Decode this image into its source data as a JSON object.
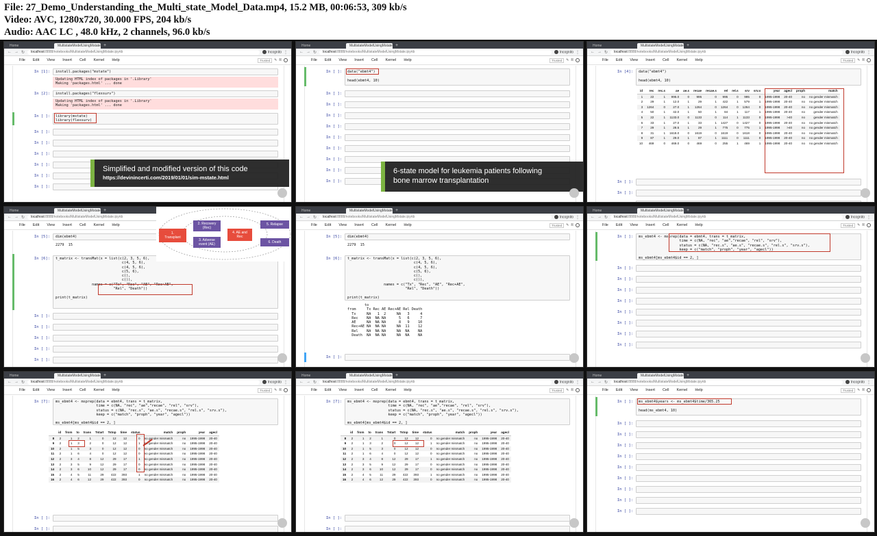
{
  "header": {
    "file_line": "File: 27_Demo_Understanding_the_Multi_state_Model_Data.mp4, 15.2 MB, 00:06:53, 309 kb/s",
    "video_line": "Video: AVC, 1280x720, 30.000 FPS, 204 kb/s",
    "audio_line": "Audio: AAC LC , 48.0 kHz, 2 channels, 96.0 kb/s"
  },
  "browser": {
    "tab_home": "Home",
    "tab_nb": "MultistateModelUsingMstate",
    "url_host": "localhost",
    "url_path": ":8888/notebooks/MultistateModelUsingMstate.ipynb",
    "incognito": "Incognito",
    "trusted": "Trusted",
    "kernel_label": "R"
  },
  "menu": [
    "File",
    "Edit",
    "View",
    "Insert",
    "Cell",
    "Kernel",
    "Help"
  ],
  "thumb0": {
    "p1": "In [1]:",
    "c1": "install.packages(\"mstate\")",
    "e1": "Updating HTML index of packages in '.Library'\nMaking 'packages.html' ... done",
    "p2": "In [2]:",
    "c2": "install.packages(\"flexsurv\")",
    "e2": "Updating HTML index of packages in '.Library'\nMaking 'packages.html' ... done",
    "p3": "In [ ]:",
    "c3": "library(mstate)\nlibrary(flexsurv)",
    "empty": "In [ ]:",
    "caption_main": "Simplified and modified version of this code",
    "caption_sub": "https://devinincerti.com/2019/01/01/sim-mstate.html"
  },
  "thumb1": {
    "p1": "In [ ]:",
    "c1": "data(\"ebmt4\")\n\nhead(ebmt4, 10)",
    "empty": "In [ ]:",
    "caption_main": "6-state model for leukemia patients following\nbone marrow transplantation"
  },
  "thumb2": {
    "p1": "In [4]:",
    "c1": "data(\"ebmt4\")\n\nhead(ebmt4, 10)",
    "empty": "In [ ]:",
    "columns": [
      "id",
      "rec",
      "rec.s",
      "ae",
      "ae.s",
      "recae",
      "recae.s",
      "rel",
      "rel.s",
      "srv",
      "srv.s",
      "year",
      "agecl",
      "proph",
      "match"
    ],
    "rows": [
      [
        "1",
        "22",
        "1",
        "995.0",
        "0",
        "995",
        "0",
        "995",
        "0",
        "995",
        "0",
        "1995-1998",
        "20-40",
        "no",
        "no gender mismatch"
      ],
      [
        "2",
        "29",
        "1",
        "12.0",
        "1",
        "29",
        "1",
        "422",
        "1",
        "579",
        "1",
        "1995-1998",
        "20-40",
        "no",
        "no gender mismatch"
      ],
      [
        "3",
        "1264",
        "0",
        "27.0",
        "1",
        "1264",
        "0",
        "1264",
        "0",
        "1264",
        "0",
        "1995-1998",
        "20-40",
        "no",
        "no gender mismatch"
      ],
      [
        "4",
        "50",
        "1",
        "42.0",
        "1",
        "50",
        "1",
        "84",
        "1",
        "117",
        "1",
        "1995-1998",
        "20-40",
        "no",
        "gender mismatch"
      ],
      [
        "5",
        "22",
        "1",
        "1133.0",
        "0",
        "1133",
        "0",
        "114",
        "1",
        "1133",
        "0",
        "1995-1998",
        ">40",
        "no",
        "gender mismatch"
      ],
      [
        "6",
        "33",
        "1",
        "27.0",
        "1",
        "33",
        "1",
        "1427",
        "0",
        "1427",
        "0",
        "1995-1998",
        "20-40",
        "no",
        "no gender mismatch"
      ],
      [
        "7",
        "29",
        "1",
        "28.5",
        "1",
        "29",
        "1",
        "775",
        "0",
        "775",
        "1",
        "1995-1998",
        ">40",
        "no",
        "no gender mismatch"
      ],
      [
        "8",
        "31",
        "1",
        "1618.0",
        "0",
        "1619",
        "0",
        "1619",
        "0",
        "1618",
        "0",
        "1995-1998",
        "20-40",
        "no",
        "no gender mismatch"
      ],
      [
        "9",
        "87",
        "1",
        "29.0",
        "1",
        "87",
        "1",
        "1111",
        "0",
        "1111",
        "0",
        "1995-1998",
        "20-40",
        "no",
        "no gender mismatch"
      ],
      [
        "10",
        "469",
        "0",
        "469.0",
        "0",
        "469",
        "0",
        "255",
        "1",
        "469",
        "1",
        "1995-1998",
        "20-40",
        "no",
        "no gender mismatch"
      ]
    ]
  },
  "thumb3": {
    "p1": "In [5]:",
    "c1": "dim(ebmt4)",
    "o1": "2279  15",
    "p2": "In [6]:",
    "c2": "t_matrix <- transMat(x = list(c(2, 3, 5, 6),\n                               c(4, 5, 6),\n                               c(4, 5, 6),\n                               c(5, 6),\n                               c(),\n                               c()),\n                 names = c(\"Tx\", \"Rec\", \"AE\", \"Rec+AE\",\n                           \"Rel\", \"Death\"))\n\nprint(t_matrix)",
    "empty": "In [ ]:",
    "d_transplant": "1.\nTransplant",
    "d_recovery": "2. Recovery\n(Rec)",
    "d_adverse": "3. Adverse\nevent (AE)",
    "d_aerec": "4. AE and\nRec",
    "d_relapse": "5. Relapse",
    "d_death": "6. Death"
  },
  "thumb4": {
    "p1": "In [5]:",
    "c1": "dim(ebmt4)",
    "o1": "2279  15",
    "p2": "In [6]:",
    "c2": "t_matrix <- transMat(x = list(c(2, 3, 5, 6),\n                               c(4, 5, 6),\n                               c(4, 5, 6),\n                               c(5, 6),\n                               c(),\n                               c()),\n                 names = c(\"Tx\", \"Rec\", \"AE\", \"Rec+AE\",\n                           \"Rel\", \"Death\"))\n\nprint(t_matrix)",
    "o2": "        to\nfrom     Tx Rec AE Rec+AE Rel Death\n  Tx     NA   1  2     NA   3     4\n  Rec    NA  NA NA      5   6     7\n  AE     NA  NA NA      8   9    10\n  Rec+AE NA  NA NA     NA  11    12\n  Rel    NA  NA NA     NA  NA    NA\n  Death  NA  NA NA     NA  NA    NA",
    "empty": "In [ ]:"
  },
  "thumb5": {
    "p1": "In [ ]:",
    "c1": "ms_ebmt4 <- msprep(data = ebmt4, trans = t_matrix,\n                   time = c(NA, \"rec\", \"ae\",\"recae\", \"rel\", \"srv\"),\n                   status = c(NA, \"rec.s\", \"ae.s\", \"recae.s\", \"rel.s\", \"srv.s\"),\n                   keep = c(\"match\", \"proph\", \"year\", \"agecl\"))\n\nms_ebmt4[ms_ebmt4$id == 2, ]",
    "empty": "In [ ]:"
  },
  "thumb6": {
    "p1": "In [7]:",
    "c1": "ms_ebmt4 <- msprep(data = ebmt4, trans = t_matrix,\n                   time = c(NA, \"rec\", \"ae\",\"recae\", \"rel\", \"srv\"),\n                   status = c(NA, \"rec.s\", \"ae.s\", \"recae.s\", \"rel.s\", \"srv.s\"),\n                   keep = c(\"match\", \"proph\", \"year\", \"agecl\"))\n\nms_ebmt4[ms_ebmt4$id == 2, ]",
    "empty": "In [ ]:",
    "columns": [
      "",
      "id",
      "from",
      "to",
      "trans",
      "Tstart",
      "Tstop",
      "time",
      "status",
      "match",
      "proph",
      "year",
      "agecl"
    ],
    "rows": [
      [
        "8",
        "2",
        "1",
        "2",
        "1",
        "0",
        "12",
        "12",
        "0",
        "no gender mismatch",
        "no",
        "1995-1998",
        "20-40"
      ],
      [
        "9",
        "2",
        "1",
        "3",
        "2",
        "0",
        "12",
        "12",
        "1",
        "no gender mismatch",
        "no",
        "1995-1998",
        "20-40"
      ],
      [
        "10",
        "2",
        "1",
        "5",
        "3",
        "0",
        "12",
        "12",
        "0",
        "no gender mismatch",
        "no",
        "1995-1998",
        "20-40"
      ],
      [
        "11",
        "2",
        "1",
        "6",
        "4",
        "0",
        "12",
        "12",
        "0",
        "no gender mismatch",
        "no",
        "1995-1998",
        "20-40"
      ],
      [
        "12",
        "2",
        "3",
        "4",
        "8",
        "12",
        "29",
        "17",
        "1",
        "no gender mismatch",
        "no",
        "1995-1998",
        "20-40"
      ],
      [
        "13",
        "2",
        "3",
        "5",
        "9",
        "12",
        "29",
        "17",
        "0",
        "no gender mismatch",
        "no",
        "1995-1998",
        "20-40"
      ],
      [
        "14",
        "2",
        "3",
        "6",
        "10",
        "12",
        "29",
        "17",
        "0",
        "no gender mismatch",
        "no",
        "1995-1998",
        "20-40"
      ],
      [
        "15",
        "2",
        "4",
        "5",
        "11",
        "29",
        "422",
        "393",
        "1",
        "no gender mismatch",
        "no",
        "1995-1998",
        "20-40"
      ],
      [
        "16",
        "2",
        "4",
        "6",
        "12",
        "29",
        "422",
        "393",
        "0",
        "no gender mismatch",
        "no",
        "1995-1998",
        "20-40"
      ]
    ]
  },
  "thumb7": {
    "p1": "In [7]:",
    "c1": "ms_ebmt4 <- msprep(data = ebmt4, trans = t_matrix,\n                   time = c(NA, \"rec\", \"ae\",\"recae\", \"rel\", \"srv\"),\n                   status = c(NA, \"rec.s\", \"ae.s\", \"recae.s\", \"rel.s\", \"srv.s\"),\n                   keep = c(\"match\", \"proph\", \"year\", \"agecl\"))\n\nms_ebmt4[ms_ebmt4$id == 2, ]",
    "empty": "In [ ]:"
  },
  "thumb8": {
    "p1": "In [ ]:",
    "c1": "ms_ebmt4$years <- ms_ebmt4$time/365.25\n\nhead(ms_ebmt4, 10)",
    "empty": "In [ ]:"
  },
  "colors": {
    "highlight": "#c0392b",
    "stderr_bg": "#ffdddd",
    "caption_accent": "#7cb342",
    "prompt": "#303f9f"
  }
}
